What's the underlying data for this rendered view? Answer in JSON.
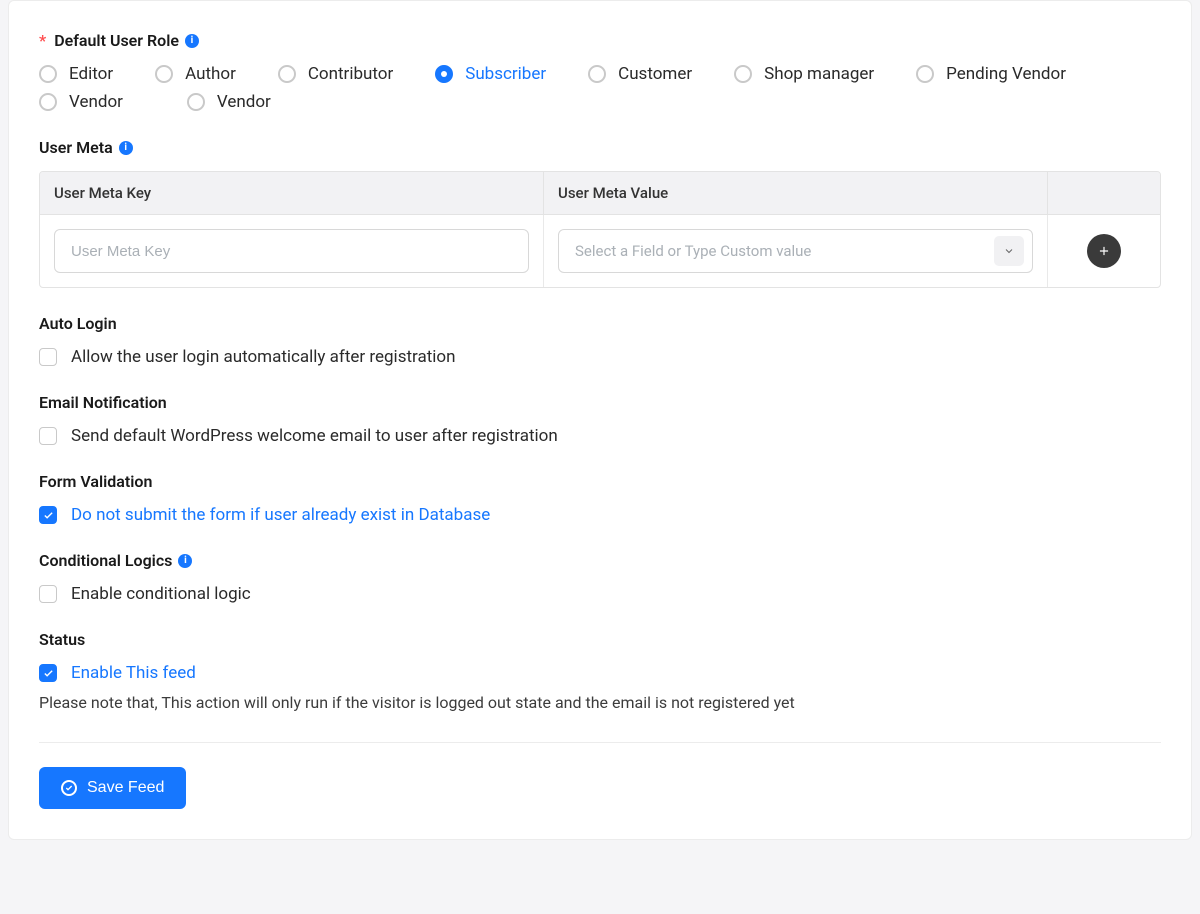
{
  "defaultRole": {
    "label": "Default User Role",
    "required": true,
    "options": [
      {
        "id": "editor",
        "label": "Editor",
        "selected": false
      },
      {
        "id": "author",
        "label": "Author",
        "selected": false
      },
      {
        "id": "contributor",
        "label": "Contributor",
        "selected": false
      },
      {
        "id": "subscriber",
        "label": "Subscriber",
        "selected": true
      },
      {
        "id": "customer",
        "label": "Customer",
        "selected": false
      },
      {
        "id": "shop-manager",
        "label": "Shop manager",
        "selected": false
      },
      {
        "id": "pending-vendor",
        "label": "Pending Vendor",
        "selected": false
      },
      {
        "id": "vendor",
        "label": "Vendor",
        "selected": false
      },
      {
        "id": "vendor2",
        "label": "Vendor",
        "selected": false
      }
    ]
  },
  "userMeta": {
    "label": "User Meta",
    "headers": {
      "key": "User Meta Key",
      "value": "User Meta Value"
    },
    "keyPlaceholder": "User Meta Key",
    "valuePlaceholder": "Select a Field or Type Custom value"
  },
  "autoLogin": {
    "label": "Auto Login",
    "checkbox": {
      "label": "Allow the user login automatically after registration",
      "checked": false
    }
  },
  "emailNotification": {
    "label": "Email Notification",
    "checkbox": {
      "label": "Send default WordPress welcome email to user after registration",
      "checked": false
    }
  },
  "formValidation": {
    "label": "Form Validation",
    "checkbox": {
      "label": "Do not submit the form if user already exist in Database",
      "checked": true
    }
  },
  "conditionalLogics": {
    "label": "Conditional Logics",
    "checkbox": {
      "label": "Enable conditional logic",
      "checked": false
    }
  },
  "status": {
    "label": "Status",
    "checkbox": {
      "label": "Enable This feed",
      "checked": true
    },
    "note": "Please note that, This action will only run if the visitor is logged out state and the email is not registered yet"
  },
  "saveButton": {
    "label": "Save Feed"
  }
}
